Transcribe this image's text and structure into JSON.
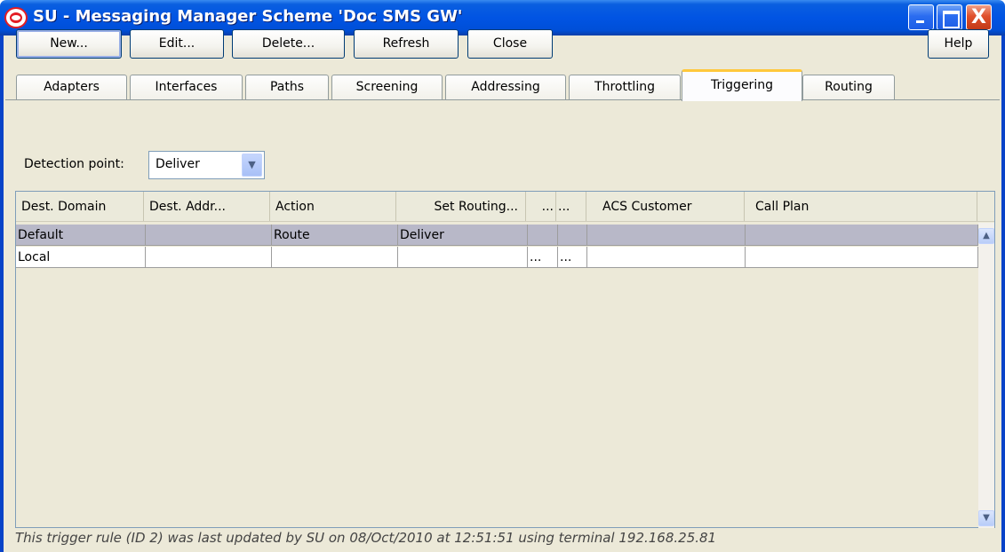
{
  "window": {
    "title": "SU - Messaging Manager Scheme 'Doc SMS GW'",
    "close_glyph": "X"
  },
  "toolbar": {
    "new_label": "New...",
    "edit_label": "Edit...",
    "delete_label": "Delete...",
    "refresh_label": "Refresh",
    "close_label": "Close",
    "help_label": "Help"
  },
  "tabs": [
    {
      "label": "Adapters"
    },
    {
      "label": "Interfaces"
    },
    {
      "label": "Paths"
    },
    {
      "label": "Screening"
    },
    {
      "label": "Addressing"
    },
    {
      "label": "Throttling"
    },
    {
      "label": "Triggering",
      "active": true
    },
    {
      "label": "Routing"
    }
  ],
  "detection": {
    "label": "Detection point:",
    "value": "Deliver"
  },
  "table": {
    "columns": [
      "Dest. Domain",
      "Dest. Addr...",
      "Action",
      "Set Routing...",
      "...",
      "...",
      "ACS Customer",
      "Call Plan"
    ],
    "rows": [
      [
        "Default",
        "",
        "Route",
        "Deliver",
        "",
        "",
        "",
        ""
      ],
      [
        "Local",
        "",
        "",
        "",
        "...",
        "...",
        "",
        ""
      ]
    ],
    "selected_row": 0
  },
  "status_text": "This trigger rule (ID 2) was last updated by SU on 08/Oct/2010 at 12:51:51 using terminal 192.168.25.81",
  "icons": {
    "app": "oracle-logo-icon",
    "dropdown": "chevron-down-icon",
    "scroll_up": "scroll-up-icon",
    "scroll_down": "scroll-down-icon"
  }
}
